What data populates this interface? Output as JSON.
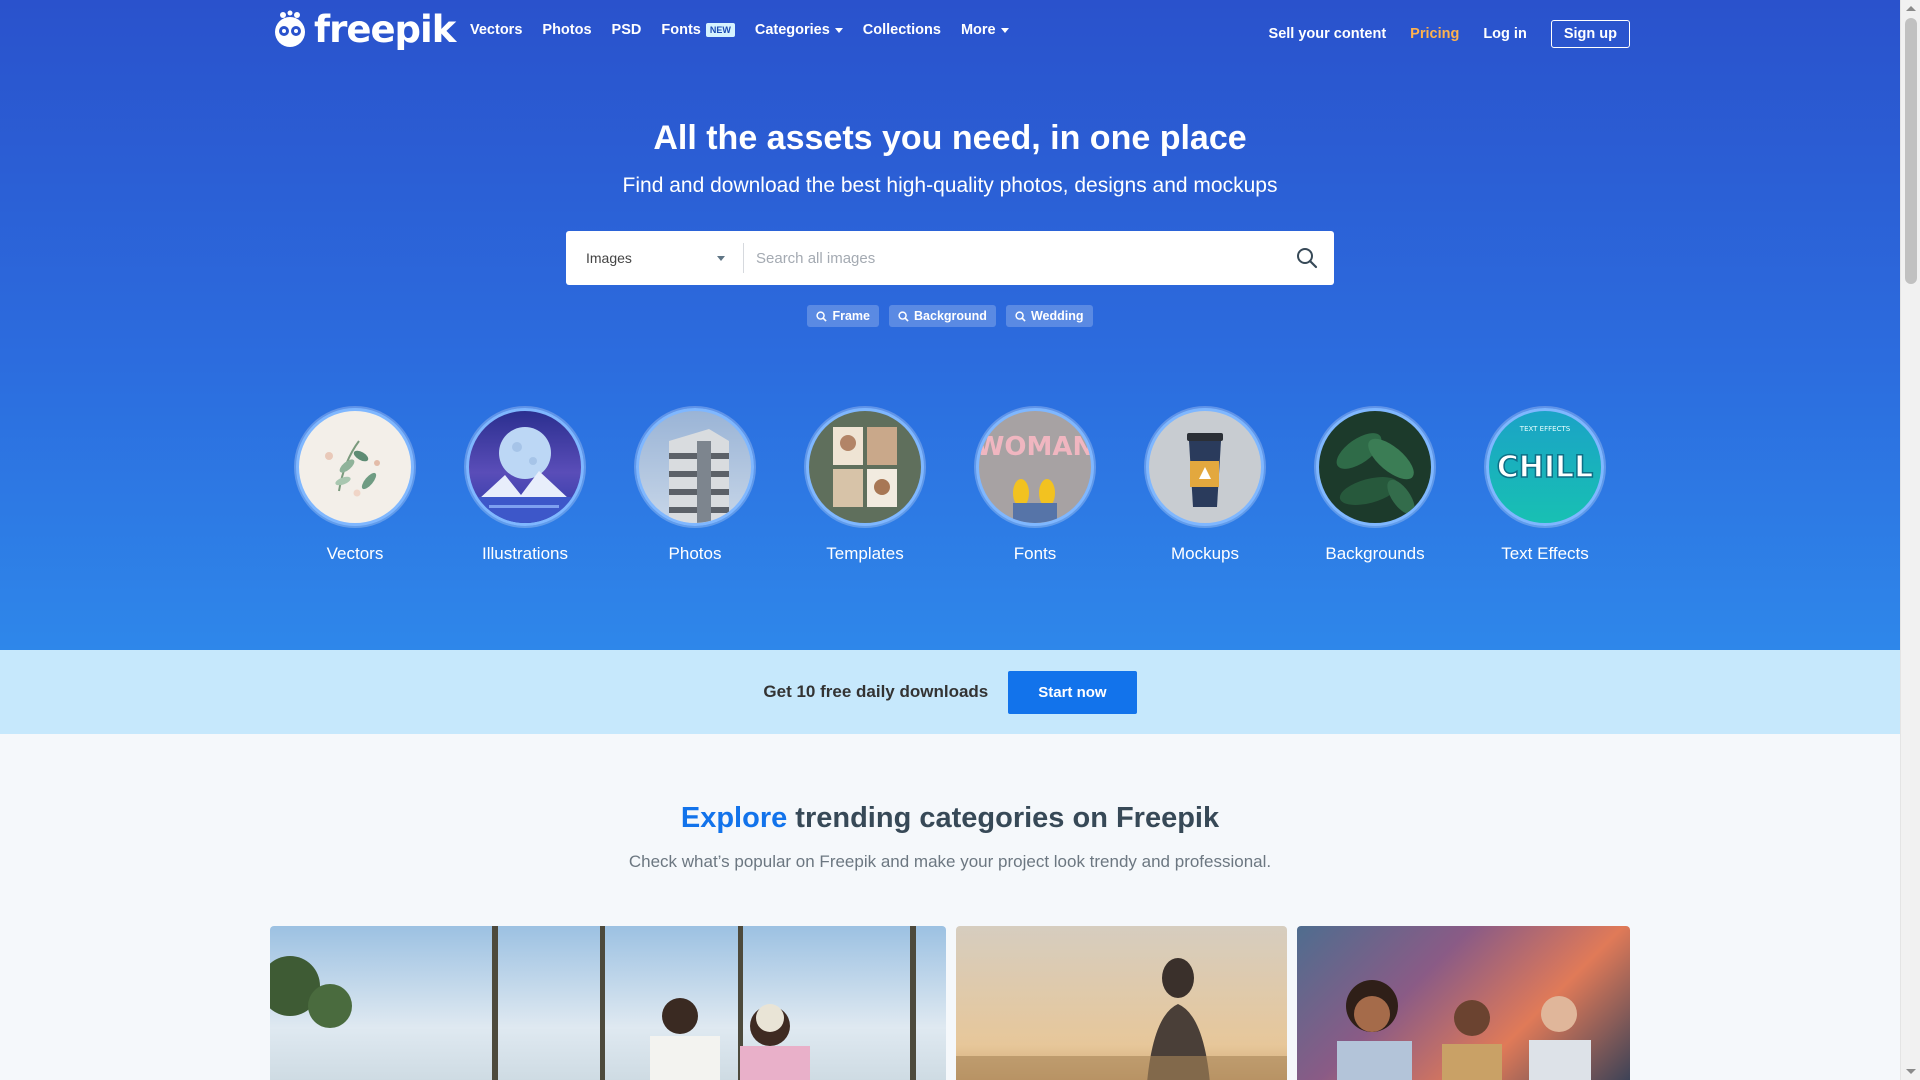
{
  "nav": {
    "logo_text": "freepik",
    "links": [
      {
        "label": "Vectors"
      },
      {
        "label": "Photos"
      },
      {
        "label": "PSD"
      },
      {
        "label": "Fonts",
        "badge": "NEW"
      },
      {
        "label": "Categories"
      },
      {
        "label": "Collections"
      },
      {
        "label": "More"
      }
    ],
    "sell": "Sell your content",
    "pricing": "Pricing",
    "login": "Log in",
    "signup": "Sign up"
  },
  "hero": {
    "title": "All the assets you need, in one place",
    "subtitle": "Find and download the best high-quality photos, designs and mockups"
  },
  "search": {
    "type_selected": "Images",
    "placeholder": "Search all images"
  },
  "tags": [
    "Frame",
    "Background",
    "Wedding"
  ],
  "categories": [
    {
      "label": "Vectors",
      "icon": "leaves-illustration"
    },
    {
      "label": "Illustrations",
      "icon": "moon-mountains-illustration"
    },
    {
      "label": "Photos",
      "icon": "building-photo"
    },
    {
      "label": "Templates",
      "icon": "moodboard-template"
    },
    {
      "label": "Fonts",
      "icon": "woman-lettering-font"
    },
    {
      "label": "Mockups",
      "icon": "coffee-cup-mockup"
    },
    {
      "label": "Backgrounds",
      "icon": "leaf-background"
    },
    {
      "label": "Text Effects",
      "icon": "chill-text-effect",
      "thumb_text": {
        "top": "TEXT EFFECTS",
        "main": "CHILL"
      }
    }
  ],
  "banner": {
    "text": "Get 10 free daily downloads",
    "button": "Start now"
  },
  "explore": {
    "title_highlight": "Explore",
    "title_rest": " trending categories on Freepik",
    "subtitle": "Check what’s popular on Freepik and make your project look trendy and professional."
  },
  "trending_photos": [
    {
      "name": "friends-at-beach-photo"
    },
    {
      "name": "woman-sunset-photo"
    },
    {
      "name": "office-team-laughing-photo"
    }
  ],
  "colors": {
    "hero_top": "#2a52cc",
    "hero_bottom": "#2e87ea",
    "accent": "#1273eb",
    "pricing": "#ffb24d",
    "banner_bg": "#c6e8fc"
  }
}
